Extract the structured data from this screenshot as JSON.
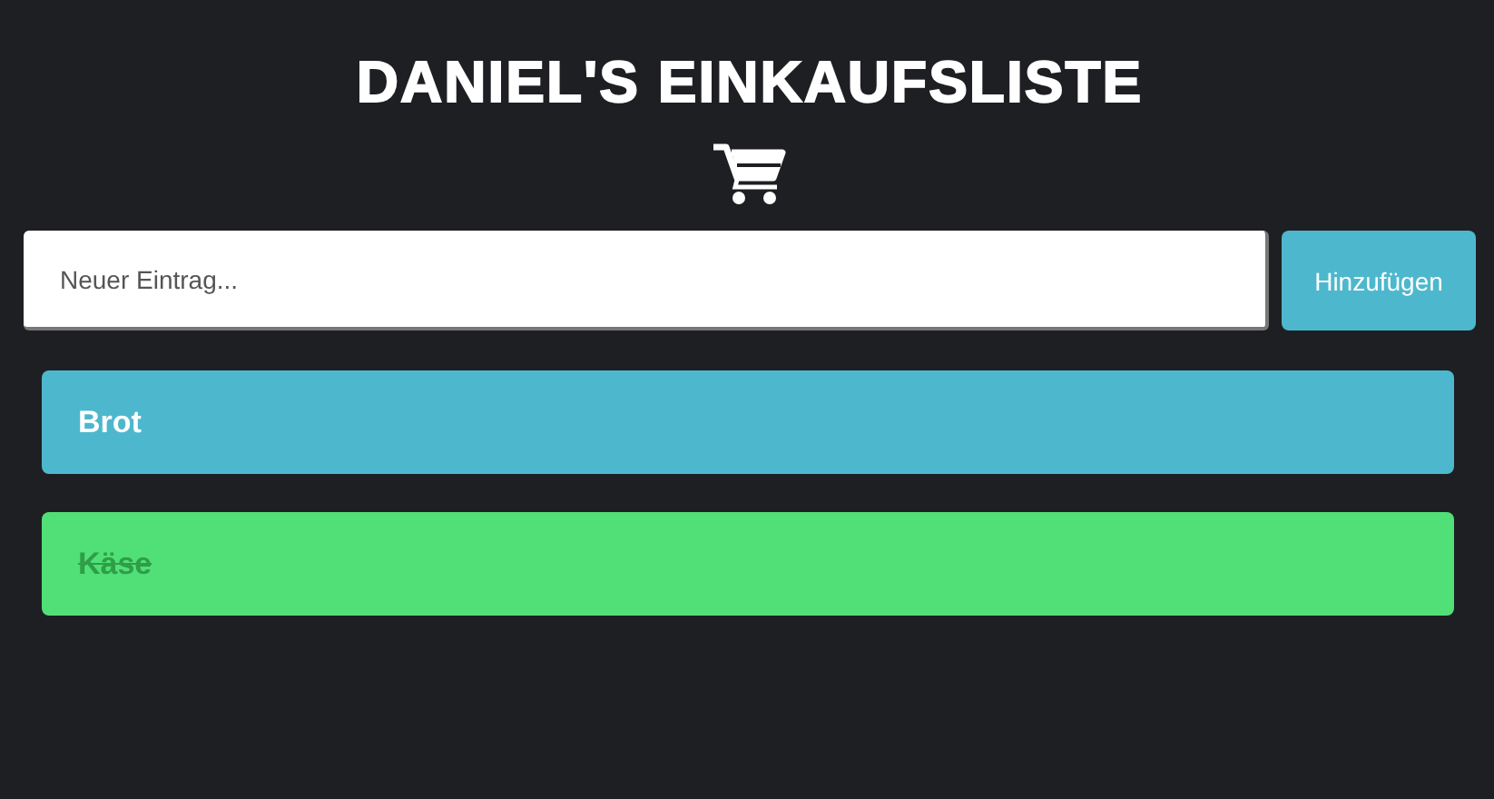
{
  "title": "DANIEL'S EINKAUFSLISTE",
  "entry": {
    "placeholder": "Neuer Eintrag...",
    "button": "Hinzufügen"
  },
  "items": [
    {
      "label": "Brot",
      "done": false
    },
    {
      "label": "Käse",
      "done": true
    }
  ]
}
